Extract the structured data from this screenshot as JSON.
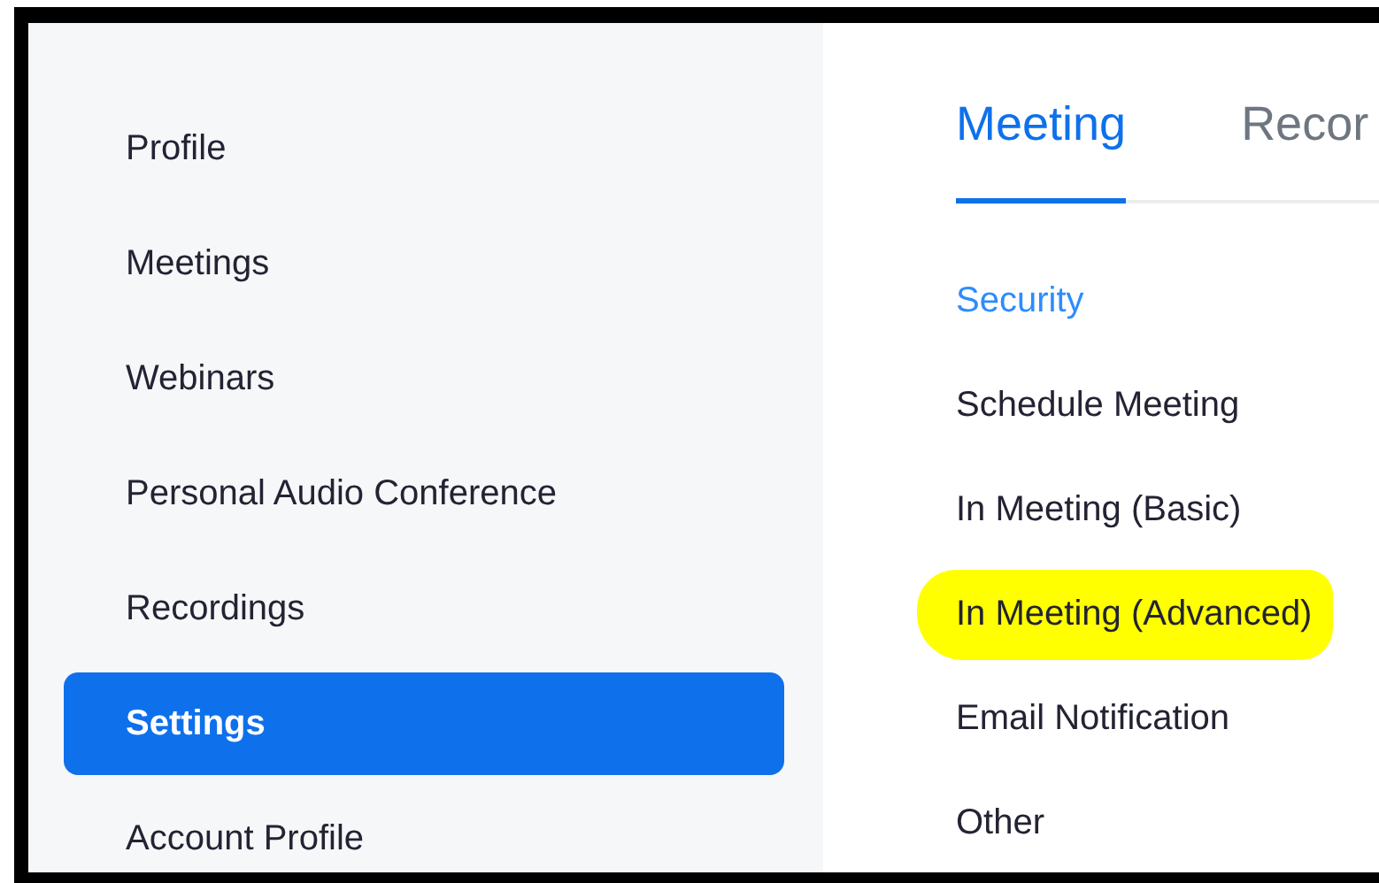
{
  "sidebar": {
    "items": [
      {
        "label": "Profile",
        "selected": false
      },
      {
        "label": "Meetings",
        "selected": false
      },
      {
        "label": "Webinars",
        "selected": false
      },
      {
        "label": "Personal Audio Conference",
        "selected": false
      },
      {
        "label": "Recordings",
        "selected": false
      },
      {
        "label": "Settings",
        "selected": true
      },
      {
        "label": "Account Profile",
        "selected": false
      }
    ]
  },
  "tabs": [
    {
      "label": "Meeting",
      "selected": true
    },
    {
      "label": "Recor",
      "selected": false
    }
  ],
  "sections": [
    {
      "label": "Security",
      "selected": true,
      "highlighted": false
    },
    {
      "label": "Schedule Meeting",
      "selected": false,
      "highlighted": false
    },
    {
      "label": "In Meeting (Basic)",
      "selected": false,
      "highlighted": false
    },
    {
      "label": "In Meeting (Advanced)",
      "selected": false,
      "highlighted": true
    },
    {
      "label": "Email Notification",
      "selected": false,
      "highlighted": false
    },
    {
      "label": "Other",
      "selected": false,
      "highlighted": false
    }
  ]
}
